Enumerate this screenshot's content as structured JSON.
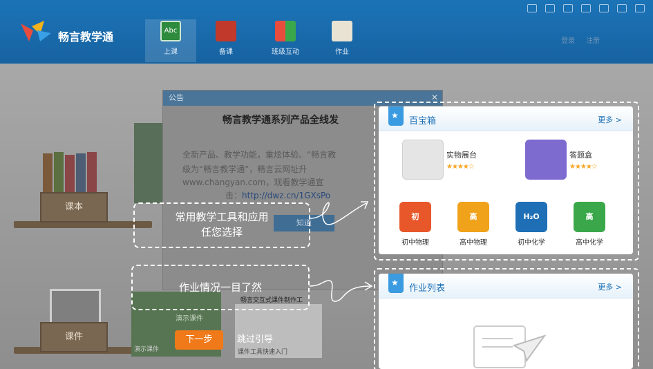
{
  "header": {
    "brand": "畅言教学通",
    "nav": [
      {
        "label": "上课",
        "icon": "abc-icon"
      },
      {
        "label": "备课",
        "icon": "book-icon"
      },
      {
        "label": "班级互动",
        "icon": "blocks-icon"
      },
      {
        "label": "作业",
        "icon": "notebook-icon"
      }
    ],
    "login": "登录",
    "register": "注册"
  },
  "scene": {
    "box_textbook": "课本",
    "box_courseware": "课件"
  },
  "notice": {
    "title": "公告",
    "heading": "畅言教学通系列产品全线发",
    "line1": "全新产品、教学功能，重炫体验。“畅言教",
    "line2": "级为“畅言教学通”，畅言云网址升",
    "line3": "www.changyan.com，观看教学通宣",
    "line4_prefix": "击：",
    "link": "http://dwz.cn/1GXsPo",
    "ok": "知道",
    "caption": "畅言交互式课件制作工",
    "label_demo": "演示课件",
    "label_tool": "课件工具快速入门",
    "label_tool2": "演示课件"
  },
  "guide": {
    "callout1_line1": "常用教学工具和应用",
    "callout1_line2": "任您选择",
    "callout2": "作业情况一目了然",
    "next": "下一步",
    "skip": "跳过引导"
  },
  "toolbox": {
    "title": "百宝箱",
    "more": "更多 >",
    "apps": [
      {
        "name": "实物展台",
        "stars": "★★★★☆"
      },
      {
        "name": "答题盒",
        "stars": "★★★★☆"
      }
    ],
    "subjects": [
      {
        "name": "初中物理",
        "badge": "初",
        "color": "#e8572a"
      },
      {
        "name": "高中物理",
        "badge": "高",
        "color": "#f0a21b"
      },
      {
        "name": "初中化学",
        "badge": "H₂O",
        "color": "#1e6fb5"
      },
      {
        "name": "高中化学",
        "badge": "高",
        "color": "#3aa84a"
      }
    ]
  },
  "homework": {
    "title": "作业列表",
    "more": "更多 >"
  }
}
